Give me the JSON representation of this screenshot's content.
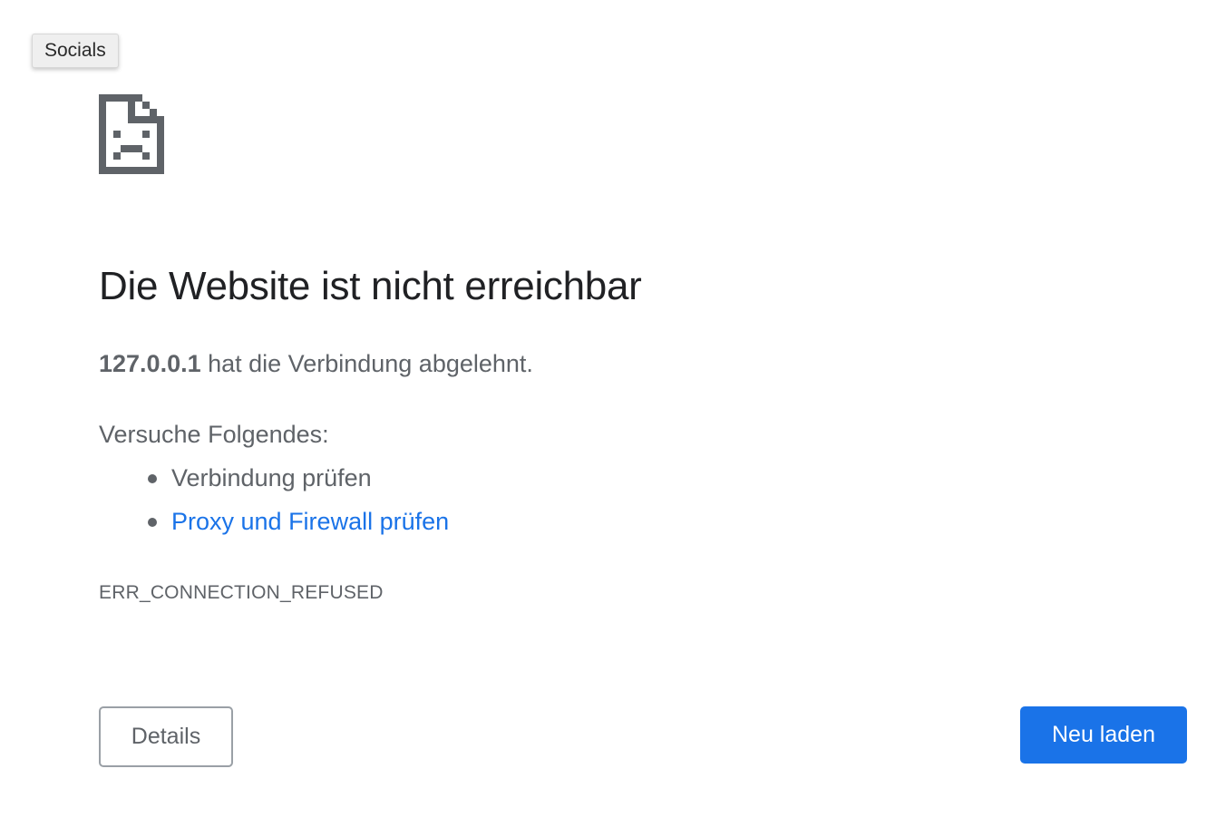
{
  "tooltip": {
    "text": "Socials"
  },
  "error_icon": {
    "name": "sad-page-icon",
    "color": "#5f6368"
  },
  "main": {
    "title": "Die Website ist nicht erreichbar",
    "host": "127.0.0.1",
    "summary_rest": " hat die Verbindung abgelehnt.",
    "suggestions_heading": "Versuche Folgendes:",
    "suggestions": [
      {
        "label": "Verbindung prüfen",
        "is_link": false
      },
      {
        "label": "Proxy und Firewall prüfen",
        "is_link": true
      }
    ],
    "error_code": "ERR_CONNECTION_REFUSED"
  },
  "buttons": {
    "details_label": "Details",
    "reload_label": "Neu laden"
  },
  "colors": {
    "link": "#1a73e8",
    "primary_button": "#1a73e8",
    "text": "#5f6368",
    "heading": "#202124"
  }
}
